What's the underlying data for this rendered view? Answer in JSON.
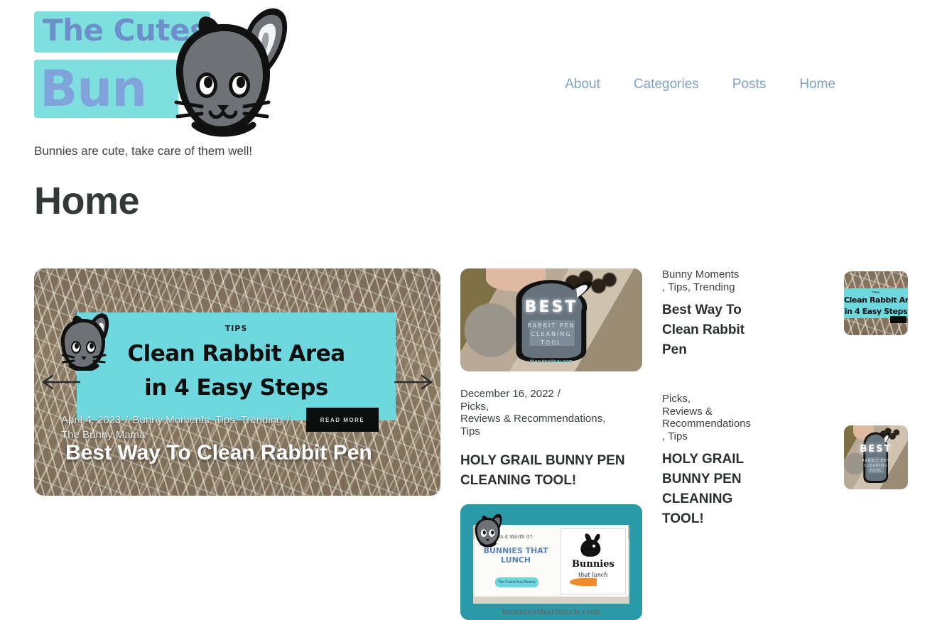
{
  "site": {
    "logo_line1": "The Cutest",
    "logo_line2": "Bun",
    "tagline": "Bunnies are cute, take care of them well!",
    "accent_cyan": "#7fdfdf",
    "logo_blue": "#6d8fcb",
    "nav_link_color": "#7ba3c4"
  },
  "nav": {
    "items": [
      {
        "label": "About"
      },
      {
        "label": "Categories"
      },
      {
        "label": "Posts"
      },
      {
        "label": "Home"
      }
    ]
  },
  "page": {
    "title": "Home"
  },
  "hero": {
    "date": "April 4, 2023",
    "separator": "/",
    "categories": "Bunny Moments, Tips, Trending",
    "author": "The Bunny Mama",
    "title": "Best Way To Clean Rabbit Pen",
    "prev_label": "Previous slide",
    "next_label": "Next slide",
    "image": {
      "overlay_kicker": "TIPS",
      "overlay_line1": "Clean Rabbit Area",
      "overlay_line2": "in 4 Easy Steps",
      "read_more": "READ MORE"
    }
  },
  "middle_column": {
    "post": {
      "date": "December 16, 2022",
      "separator": "/",
      "categories_line1": "Picks,",
      "categories_line2": "Reviews & Recommendations,",
      "categories_line3": "Tips",
      "title": "HOLY GRAIL BUNNY PEN CLEANING TOOL!",
      "image": {
        "badge_title": "BEST",
        "badge_line1": "RABBIT PEN",
        "badge_line2": "CLEANING",
        "badge_line3": "TOOL",
        "badge_url": "thecutestbun.com"
      }
    },
    "bottom_image": {
      "kicker": "Is it Worth it?",
      "title_line1": "BUNNIES THAT",
      "title_line2": "LUNCH",
      "pill": "The Cutest Bun Review",
      "brand_name": "Bunnies",
      "brand_sub": "that lunch",
      "url": "bunniesthatlunch.com"
    }
  },
  "right_column": {
    "posts": [
      {
        "categories_line1": "Bunny Moments",
        "categories_line2": ", Tips, Trending",
        "title": "Best Way To Clean Rabbit Pen",
        "thumb": {
          "kicker": "TIPS",
          "line1": "Clean Rabbit Area",
          "line2": "in 4 Easy Steps"
        }
      },
      {
        "categories_line1": "Picks,",
        "categories_line2": "Reviews &",
        "categories_line3": "Recommendations",
        "categories_line4": ", Tips",
        "title": "HOLY GRAIL BUNNY PEN CLEANING TOOL!",
        "thumb": {
          "badge_title": "BEST",
          "badge_line1": "RABBIT PEN",
          "badge_line2": "CLEANING",
          "badge_line3": "TOOL"
        }
      }
    ]
  }
}
